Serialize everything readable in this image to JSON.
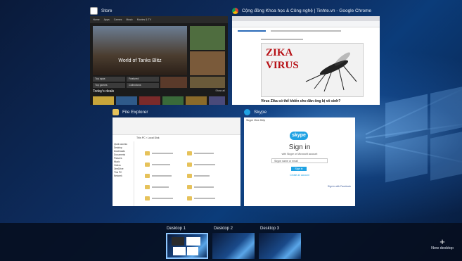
{
  "windows": {
    "store": {
      "title": "Store",
      "nav": [
        "Home",
        "Apps",
        "Games",
        "Music",
        "Movies & TV"
      ],
      "hero_title": "World of Tanks Blitz",
      "tiles": [
        "Top apps",
        "Top games",
        "Featured",
        "Collections"
      ],
      "section": "Today's deals",
      "show_all": "Show all"
    },
    "chrome": {
      "title": "Cộng đồng Khoa học & Công nghệ | Tinhte.vn - Google Chrome",
      "image_text_line1": "ZIKA",
      "image_text_line2": "VIRUS",
      "headline": "Virus Zika có thể khiến cho đàn ông bị vô sinh?"
    },
    "explorer": {
      "title": "File Explorer",
      "address": "This PC › Local Disk",
      "tree": [
        "Quick access",
        "Desktop",
        "Downloads",
        "Documents",
        "Pictures",
        "Music",
        "Videos",
        "OneDrive",
        "This PC",
        "Network"
      ]
    },
    "skype": {
      "title": "Skype",
      "menu": "Skype  View  Help",
      "logo": "skype",
      "heading": "Sign in",
      "subheading": "with Skype or Microsoft account",
      "input_value": "Skype name or email",
      "button": "Sign in",
      "create_account": "Create an account",
      "facebook": "Sign in with Facebook"
    }
  },
  "desktops": [
    "Desktop 1",
    "Desktop 2",
    "Desktop 3"
  ],
  "active_desktop_index": 0,
  "new_desktop": "New desktop",
  "colors": {
    "accent": "#8ec7ff",
    "skype_blue": "#1fa2e3",
    "zika_red": "#b60f14"
  }
}
